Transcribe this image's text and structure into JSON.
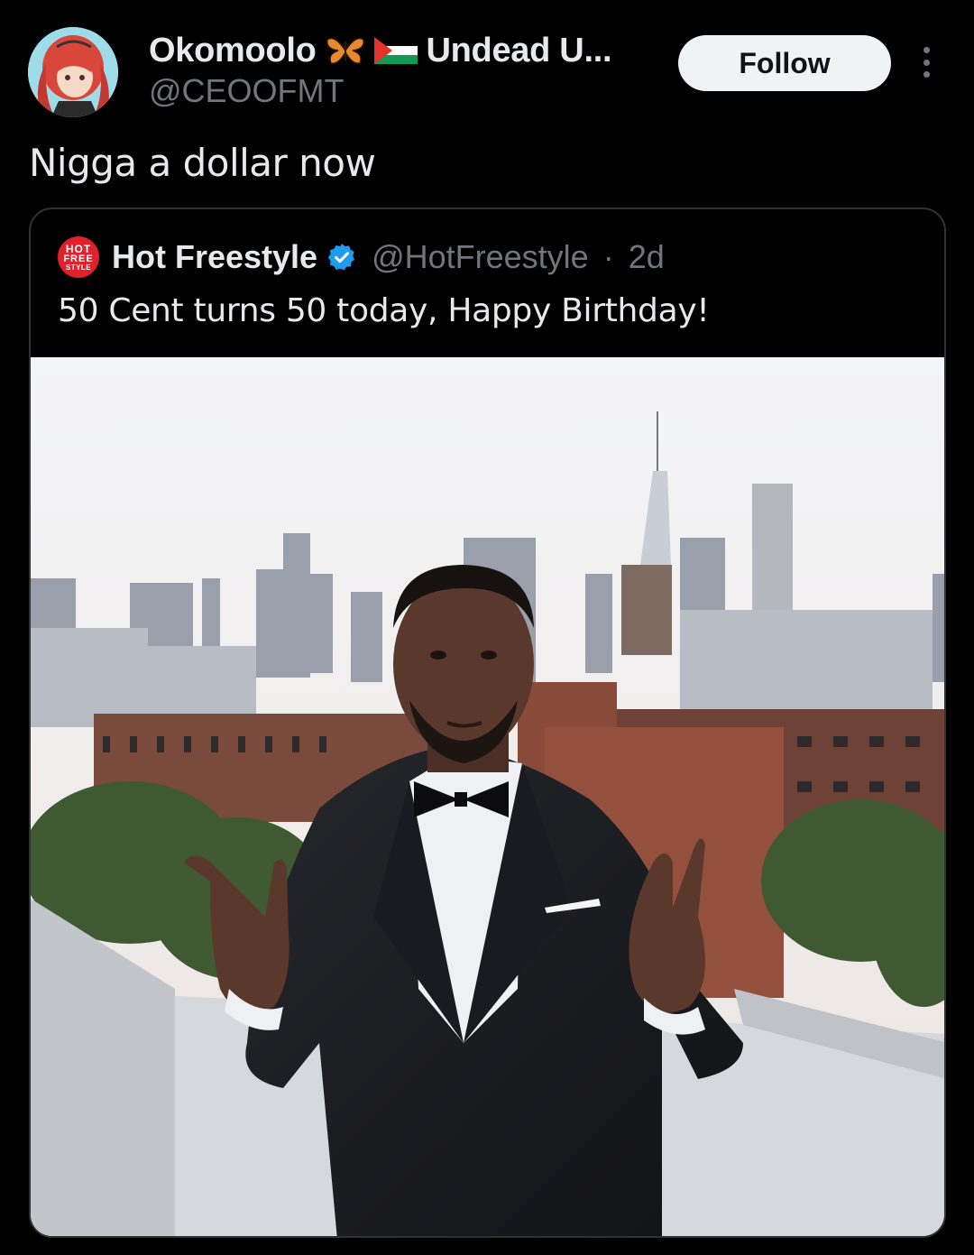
{
  "author": {
    "display_name": "Okomoolo",
    "name_suffix": "Undead U...",
    "handle": "@CEOOFMT",
    "emoji_icons": [
      "butterfly-icon",
      "palestine-flag-icon"
    ]
  },
  "follow_label": "Follow",
  "more_icon": "more-options-icon",
  "tweet_text": "Nigga a dollar now",
  "quote": {
    "logo_lines": [
      "HOT",
      "FREE",
      "STYLE"
    ],
    "name": "Hot Freestyle",
    "verified_icon": "verified-badge-icon",
    "handle": "@HotFreestyle",
    "separator": "·",
    "time": "2d",
    "text": "50 Cent turns 50 today, Happy Birthday!",
    "media_icon": "photo-man-in-tuxedo-on-rooftop-city-skyline"
  },
  "colors": {
    "background": "#000000",
    "text": "#e7e9ea",
    "secondary_text": "#71767b",
    "follow_bg": "#eff3f4",
    "verified_blue": "#1d9bf0",
    "border": "#2f3336"
  }
}
